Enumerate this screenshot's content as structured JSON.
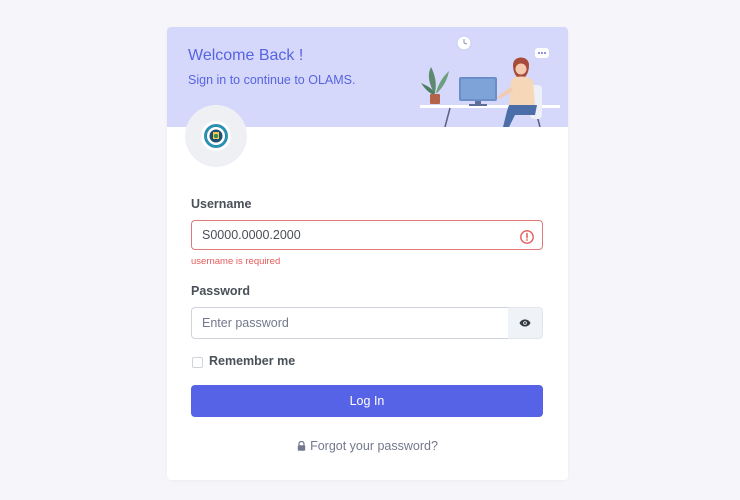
{
  "header": {
    "title": "Welcome Back !",
    "subtitle": "Sign in to continue to OLAMS."
  },
  "form": {
    "username_label": "Username",
    "username_value": "S0000.0000.2000",
    "username_error": "username is required",
    "password_label": "Password",
    "password_placeholder": "Enter password",
    "remember_label": "Remember me",
    "login_label": "Log In",
    "forgot_label": "Forgot your password?"
  },
  "icons": {
    "error": "exclamation-circle-icon",
    "show_password": "eye-icon",
    "forgot": "lock-icon"
  },
  "colors": {
    "primary": "#5663e6",
    "banner_bg": "#d5d8fb",
    "banner_text": "#5764e0",
    "error": "#e45b5b"
  }
}
